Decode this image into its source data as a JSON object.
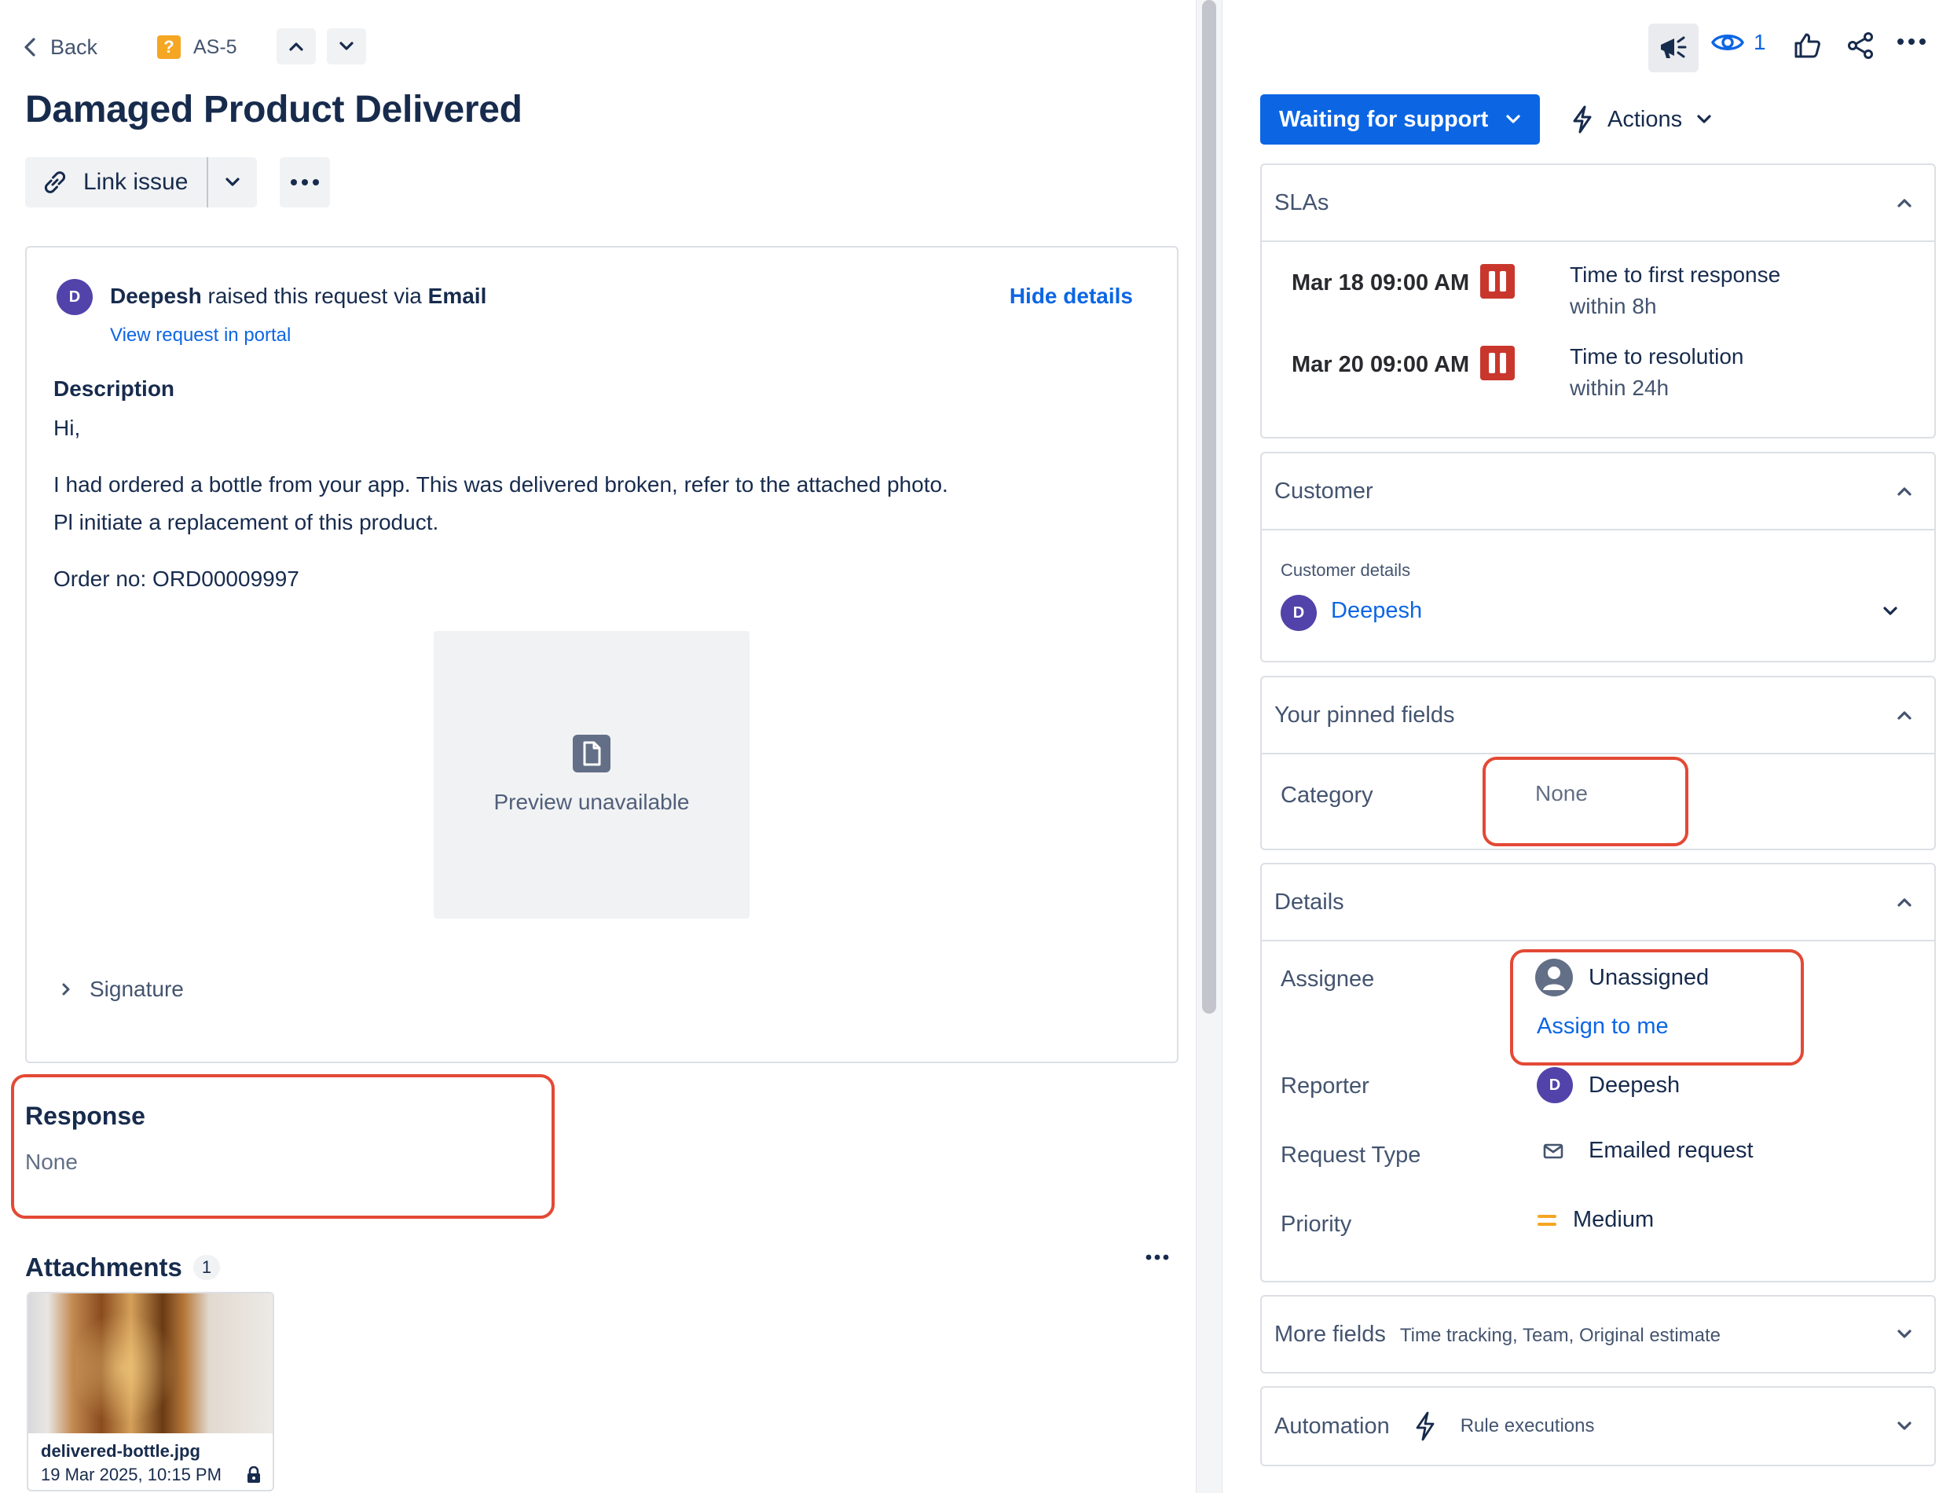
{
  "nav": {
    "back_label": "Back",
    "issue_key": "AS-5",
    "issue_type_icon": "question-mark-icon"
  },
  "issue": {
    "title": "Damaged Product Delivered",
    "link_issue_label": "Link issue"
  },
  "request": {
    "avatar_initial": "D",
    "raiser_name": "Deepesh",
    "raised_text": "raised this request via",
    "channel": "Email",
    "view_portal_label": "View request in portal",
    "hide_details_label": "Hide details",
    "description_label": "Description",
    "description_lines": [
      "Hi,",
      "I had ordered a bottle from your app. This was delivered broken, refer to the attached photo.",
      "Pl initiate a replacement of this product.",
      "Order no: ORD00009997"
    ],
    "preview_text": "Preview unavailable",
    "signature_label": "Signature"
  },
  "response": {
    "title": "Response",
    "value": "None"
  },
  "attachments": {
    "title": "Attachments",
    "count": "1",
    "items": [
      {
        "name": "delivered-bottle.jpg",
        "date": "19 Mar 2025, 10:15 PM"
      }
    ]
  },
  "toolbar": {
    "watch_count": "1"
  },
  "status": {
    "label": "Waiting for support",
    "actions_label": "Actions"
  },
  "slas": {
    "title": "SLAs",
    "items": [
      {
        "date": "Mar 18 09:00 AM",
        "goal": "Time to first response",
        "target": "within 8h"
      },
      {
        "date": "Mar 20 09:00 AM",
        "goal": "Time to resolution",
        "target": "within 24h"
      }
    ]
  },
  "customer": {
    "title": "Customer",
    "details_label": "Customer details",
    "avatar_initial": "D",
    "name": "Deepesh"
  },
  "pinned": {
    "title": "Your pinned fields",
    "category_label": "Category",
    "category_value": "None"
  },
  "details": {
    "title": "Details",
    "assignee_label": "Assignee",
    "assignee_value": "Unassigned",
    "assign_to_me_label": "Assign to me",
    "reporter_label": "Reporter",
    "reporter_avatar_initial": "D",
    "reporter_value": "Deepesh",
    "request_type_label": "Request Type",
    "request_type_value": "Emailed request",
    "priority_label": "Priority",
    "priority_value": "Medium"
  },
  "more_fields": {
    "title": "More fields",
    "subtitle": "Time tracking, Team, Original estimate"
  },
  "automation": {
    "title": "Automation",
    "subtitle": "Rule executions"
  },
  "colors": {
    "primary": "#0c66e4",
    "highlight": "#e34935",
    "sla_paused": "#c9372c",
    "avatar": "#5243aa",
    "priority_medium": "#f5a623"
  }
}
